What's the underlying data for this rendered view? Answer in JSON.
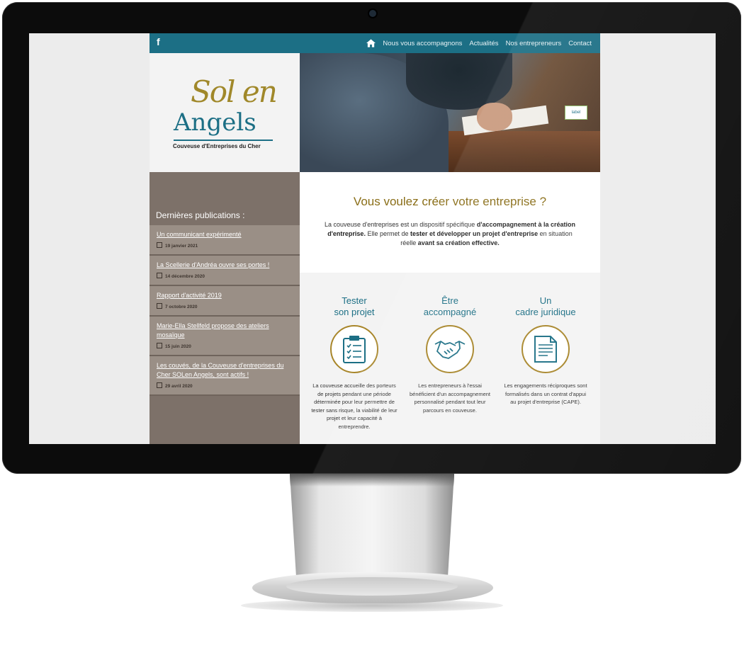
{
  "nav": {
    "facebook": "f",
    "items": [
      "Nous vous accompagnons",
      "Actualités",
      "Nos entrepreneurs",
      "Contact"
    ]
  },
  "logo": {
    "line1": "Sol en",
    "line2": "Angels",
    "tagline": "Couveuse d'Entreprises du Cher"
  },
  "hero": {
    "badge": "label"
  },
  "sidebar": {
    "title": "Dernières publications :",
    "posts": [
      {
        "title": "Un communicant expérimenté",
        "date": "19 janvier 2021"
      },
      {
        "title": "La Scellerie d'Andréa ouvre ses portes !",
        "date": "14 décembre 2020"
      },
      {
        "title": "Rapport d'activité 2019",
        "date": "7 octobre 2020"
      },
      {
        "title": "Marie-Ella Stellfeld propose des ateliers mosaïque",
        "date": "15 juin 2020"
      },
      {
        "title": "Les couvés, de la Couveuse d'entreprises du Cher SOLen Angels, sont actifs !",
        "date": "29 avril 2020"
      }
    ]
  },
  "main": {
    "title": "Vous voulez créer votre entreprise ?",
    "text_1": "La couveuse d'entreprises est un dispositif spécifique ",
    "text_2": "d'accompagnement à la création d'entreprise.",
    "text_3": " Elle permet de ",
    "text_4": "tester et développer un projet d'entreprise",
    "text_5": " en situation réelle ",
    "text_6": "avant sa création effective."
  },
  "features": [
    {
      "title_1": "Tester",
      "title_2": "son projet",
      "icon": "clipboard-icon",
      "text": "La couveuse accueille des porteurs de projets pendant une période déterminée pour leur permettre de tester sans risque, la viabilité de leur projet et leur capacité à entreprendre."
    },
    {
      "title_1": "Être",
      "title_2": "accompagné",
      "icon": "handshake-icon",
      "text": "Les entrepreneurs à l'essai bénéficient d'un accompagnement personnalisé pendant tout leur parcours en couveuse."
    },
    {
      "title_1": "Un",
      "title_2": "cadre juridique",
      "icon": "document-icon",
      "text": "Les engagements réciproques sont formalisés dans un contrat d'appui au projet d'entreprise (CAPE)."
    }
  ],
  "colors": {
    "brand_teal": "#1c6f85",
    "brand_gold": "#a8862a",
    "sidebar": "#7d7169"
  }
}
